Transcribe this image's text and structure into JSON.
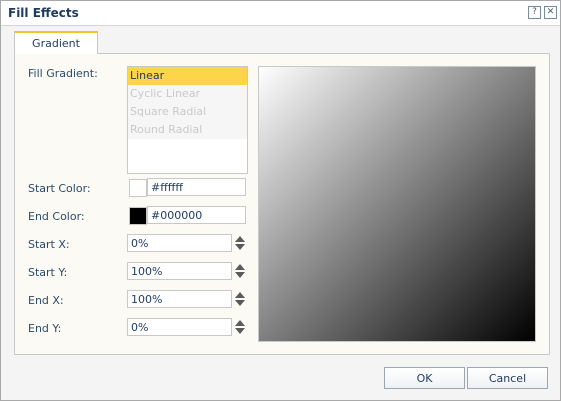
{
  "dialog": {
    "title": "Fill Effects",
    "help_label": "?",
    "close_label": "✕"
  },
  "tabs": [
    {
      "label": "Gradient"
    }
  ],
  "form": {
    "fill_gradient_label": "Fill Gradient:",
    "gradient_options": [
      "Linear",
      "Cyclic Linear",
      "Square Radial",
      "Round Radial"
    ],
    "selected_gradient": "Linear",
    "start_color_label": "Start Color:",
    "start_color_value": "#ffffff",
    "start_color_swatch": "#ffffff",
    "end_color_label": "End Color:",
    "end_color_value": "#000000",
    "end_color_swatch": "#000000",
    "start_x_label": "Start X:",
    "start_x_value": "0%",
    "start_y_label": "Start Y:",
    "start_y_value": "100%",
    "end_x_label": "End X:",
    "end_x_value": "100%",
    "end_y_label": "End Y:",
    "end_y_value": "0%"
  },
  "buttons": {
    "ok_label": "OK",
    "cancel_label": "Cancel"
  },
  "colors": {
    "accent": "#fdd44a",
    "tab_highlight": "#f2c230"
  }
}
